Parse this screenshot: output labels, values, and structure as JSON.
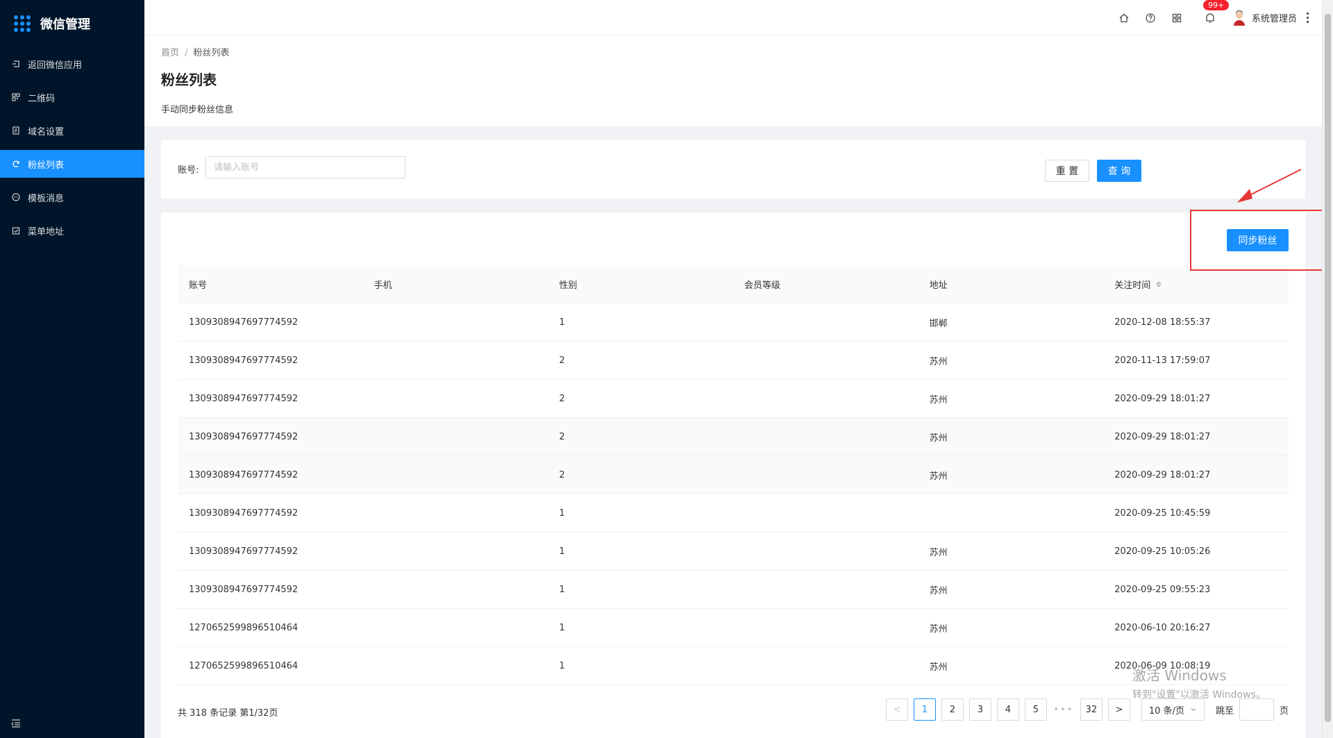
{
  "app": {
    "title": "微信管理"
  },
  "sidebar": {
    "items": [
      {
        "label": "返回微信应用",
        "icon": "back-icon"
      },
      {
        "label": "二维码",
        "icon": "qrcode-icon"
      },
      {
        "label": "域名设置",
        "icon": "domain-icon"
      },
      {
        "label": "粉丝列表",
        "icon": "sync-icon",
        "active": true
      },
      {
        "label": "模板消息",
        "icon": "message-icon"
      },
      {
        "label": "菜单地址",
        "icon": "menu-address-icon"
      }
    ]
  },
  "header": {
    "badge": "99+",
    "user_name": "系统管理员"
  },
  "breadcrumb": {
    "home": "首页",
    "current": "粉丝列表",
    "separator": "/"
  },
  "page": {
    "title": "粉丝列表",
    "description": "手动同步粉丝信息"
  },
  "search": {
    "label": "账号:",
    "placeholder": "请输入账号",
    "reset_label": "重 置",
    "query_label": "查 询"
  },
  "actions": {
    "sync_label": "同步粉丝"
  },
  "table": {
    "columns": [
      "账号",
      "手机",
      "性别",
      "会员等级",
      "地址",
      "关注时间"
    ],
    "rows": [
      [
        "1309308947697774592",
        "",
        "1",
        "",
        "邯郸",
        "2020-12-08 18:55:37"
      ],
      [
        "1309308947697774592",
        "",
        "2",
        "",
        "苏州",
        "2020-11-13 17:59:07"
      ],
      [
        "1309308947697774592",
        "",
        "2",
        "",
        "苏州",
        "2020-09-29 18:01:27"
      ],
      [
        "1309308947697774592",
        "",
        "2",
        "",
        "苏州",
        "2020-09-29 18:01:27"
      ],
      [
        "1309308947697774592",
        "",
        "2",
        "",
        "苏州",
        "2020-09-29 18:01:27"
      ],
      [
        "1309308947697774592",
        "",
        "1",
        "",
        "",
        "2020-09-25 10:45:59"
      ],
      [
        "1309308947697774592",
        "",
        "1",
        "",
        "苏州",
        "2020-09-25 10:05:26"
      ],
      [
        "1309308947697774592",
        "",
        "1",
        "",
        "苏州",
        "2020-09-25 09:55:23"
      ],
      [
        "1270652599896510464",
        "",
        "1",
        "",
        "苏州",
        "2020-06-10 20:16:27"
      ],
      [
        "1270652599896510464",
        "",
        "1",
        "",
        "苏州",
        "2020-06-09 10:08:19"
      ]
    ]
  },
  "pagination": {
    "total_text": "共 318 条记录 第1/32页",
    "prev": "<",
    "next": ">",
    "pages": [
      "1",
      "2",
      "3",
      "4",
      "5"
    ],
    "ellipsis": "•••",
    "last": "32",
    "current": "1",
    "page_size": "10 条/页",
    "jump_label": "跳至",
    "page_suffix": "页"
  },
  "watermark": {
    "line1": "激活 Windows",
    "line2": "转到\"设置\"以激活 Windows。"
  },
  "colors": {
    "primary": "#1890ff",
    "sidebar_bg": "#001529",
    "annotation": "#e53935",
    "badge": "#f5222d"
  }
}
